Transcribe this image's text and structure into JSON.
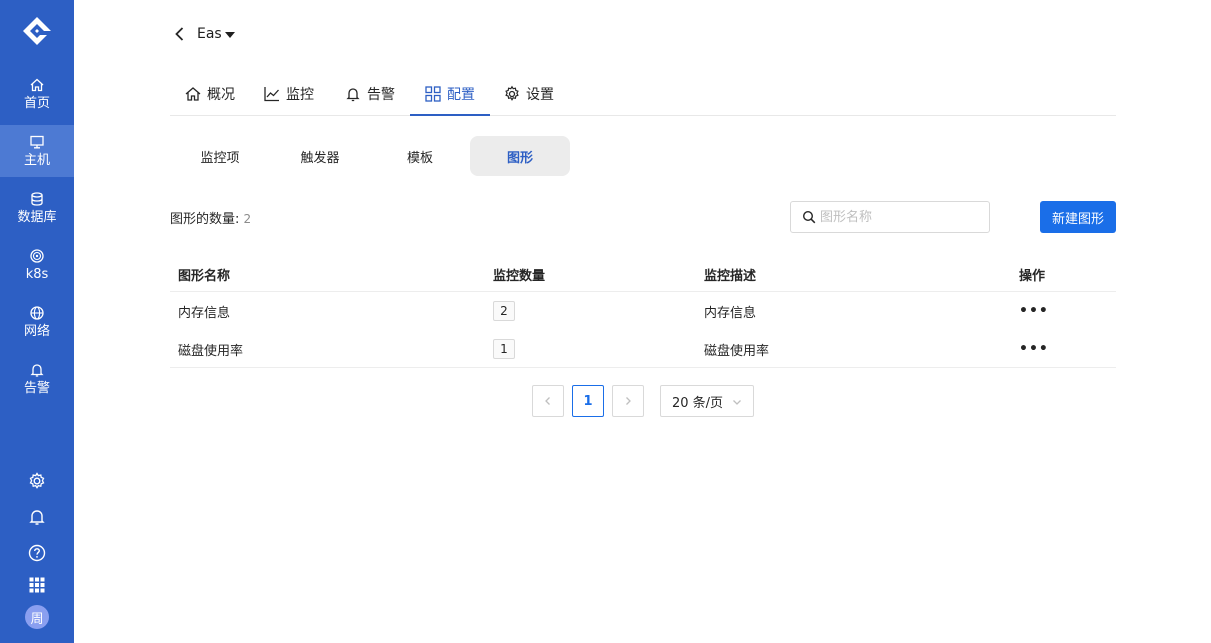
{
  "sidebar": {
    "items": [
      {
        "label": "首页",
        "icon": "home-icon"
      },
      {
        "label": "主机",
        "icon": "monitor-icon",
        "active": true
      },
      {
        "label": "数据库",
        "icon": "database-icon"
      },
      {
        "label": "k8s",
        "icon": "kubernetes-icon"
      },
      {
        "label": "网络",
        "icon": "globe-icon"
      },
      {
        "label": "告警",
        "icon": "bell-icon"
      }
    ],
    "bottom_icons": [
      "gear-icon",
      "bell-icon",
      "help-icon",
      "apps-grid-icon"
    ],
    "avatar": "周",
    "colors": {
      "background": "#2d5fc4",
      "active": "#4d7ad3"
    }
  },
  "header": {
    "host_name": "Eas"
  },
  "tabs": [
    {
      "label": "概况",
      "icon": "home-icon"
    },
    {
      "label": "监控",
      "icon": "line-chart-icon"
    },
    {
      "label": "告警",
      "icon": "bell-icon"
    },
    {
      "label": "配置",
      "icon": "grid-icon",
      "active": true
    },
    {
      "label": "设置",
      "icon": "gear-icon"
    }
  ],
  "subtabs": [
    {
      "label": "监控项"
    },
    {
      "label": "触发器"
    },
    {
      "label": "模板"
    },
    {
      "label": "图形",
      "active": true
    }
  ],
  "toolbar": {
    "count_label": "图形的数量:",
    "count_value": "2",
    "search_placeholder": "图形名称",
    "new_button_label": "新建图形"
  },
  "table": {
    "columns": [
      "图形名称",
      "监控数量",
      "监控描述",
      "操作"
    ],
    "rows": [
      {
        "name": "内存信息",
        "count": "2",
        "description": "内存信息",
        "action": "•••"
      },
      {
        "name": "磁盘使用率",
        "count": "1",
        "description": "磁盘使用率",
        "action": "•••"
      }
    ]
  },
  "pagination": {
    "current_page": "1",
    "page_size": "20 条/页"
  },
  "colors": {
    "accent": "#1a6ee8",
    "primary": "#2d5fc4"
  }
}
